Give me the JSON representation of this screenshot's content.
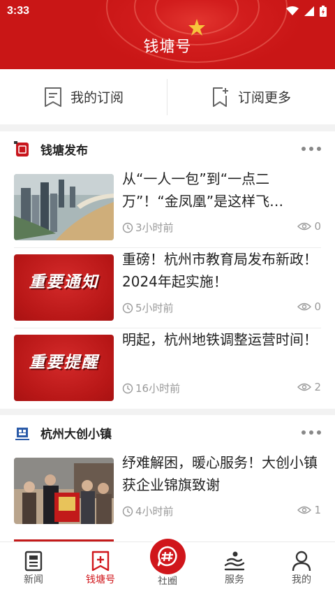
{
  "status_bar": {
    "time": "3:33"
  },
  "header": {
    "title": "钱塘号"
  },
  "subscription": {
    "my_subscriptions": "我的订阅",
    "subscribe_more": "订阅更多"
  },
  "sections": [
    {
      "name": "钱塘发布",
      "items": [
        {
          "title": "从“一人一包”到“一点二万”！“金凤凰”是这样飞…",
          "time": "3小时前",
          "views": "0"
        },
        {
          "title": "重磅！杭州市教育局发布新政！2024年起实施！",
          "time": "5小时前",
          "views": "0",
          "thumb_text": "重要通知"
        },
        {
          "title": "明起，杭州地铁调整运营时间！",
          "time": "16小时前",
          "views": "2",
          "thumb_text": "重要提醒"
        }
      ]
    },
    {
      "name": "杭州大创小镇",
      "items": [
        {
          "title": "纾难解困，暖心服务！大创小镇获企业锦旗致谢",
          "time": "4小时前",
          "views": "1"
        }
      ]
    }
  ],
  "bottom_nav": [
    {
      "label": "新闻",
      "icon": "newspaper-icon"
    },
    {
      "label": "钱塘号",
      "icon": "bookmark-plus-icon"
    },
    {
      "label": "社圈",
      "icon": "hashtag-bubble-icon"
    },
    {
      "label": "服务",
      "icon": "hand-service-icon"
    },
    {
      "label": "我的",
      "icon": "person-icon"
    }
  ],
  "colors": {
    "brand_red": "#d0161b",
    "text_gray": "#999999"
  }
}
